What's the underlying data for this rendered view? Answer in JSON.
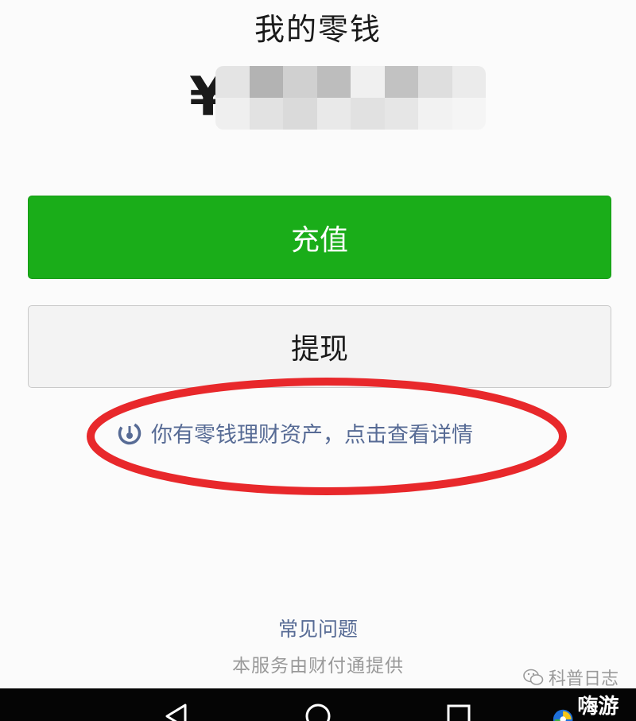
{
  "page": {
    "title": "我的零钱"
  },
  "balance": {
    "currency_symbol": "¥"
  },
  "actions": {
    "recharge_label": "充值",
    "withdraw_label": "提现"
  },
  "wealth_link": {
    "text": "你有零钱理财资产，点击查看详情"
  },
  "footer": {
    "faq_label": "常见问题",
    "provider_note": "本服务由财付通提供"
  },
  "watermarks": {
    "wechat_account": "科普日志",
    "site_name": "嗨游网"
  },
  "colors": {
    "primary_green": "#1aad19",
    "link_blue": "#576b95",
    "annotation_red": "#e8282b",
    "nav_bar": "#050505"
  },
  "icons": {
    "wealth": "wealth-asset-icon",
    "nav": [
      "back-triangle-icon",
      "home-circle-icon",
      "recents-square-icon"
    ]
  }
}
